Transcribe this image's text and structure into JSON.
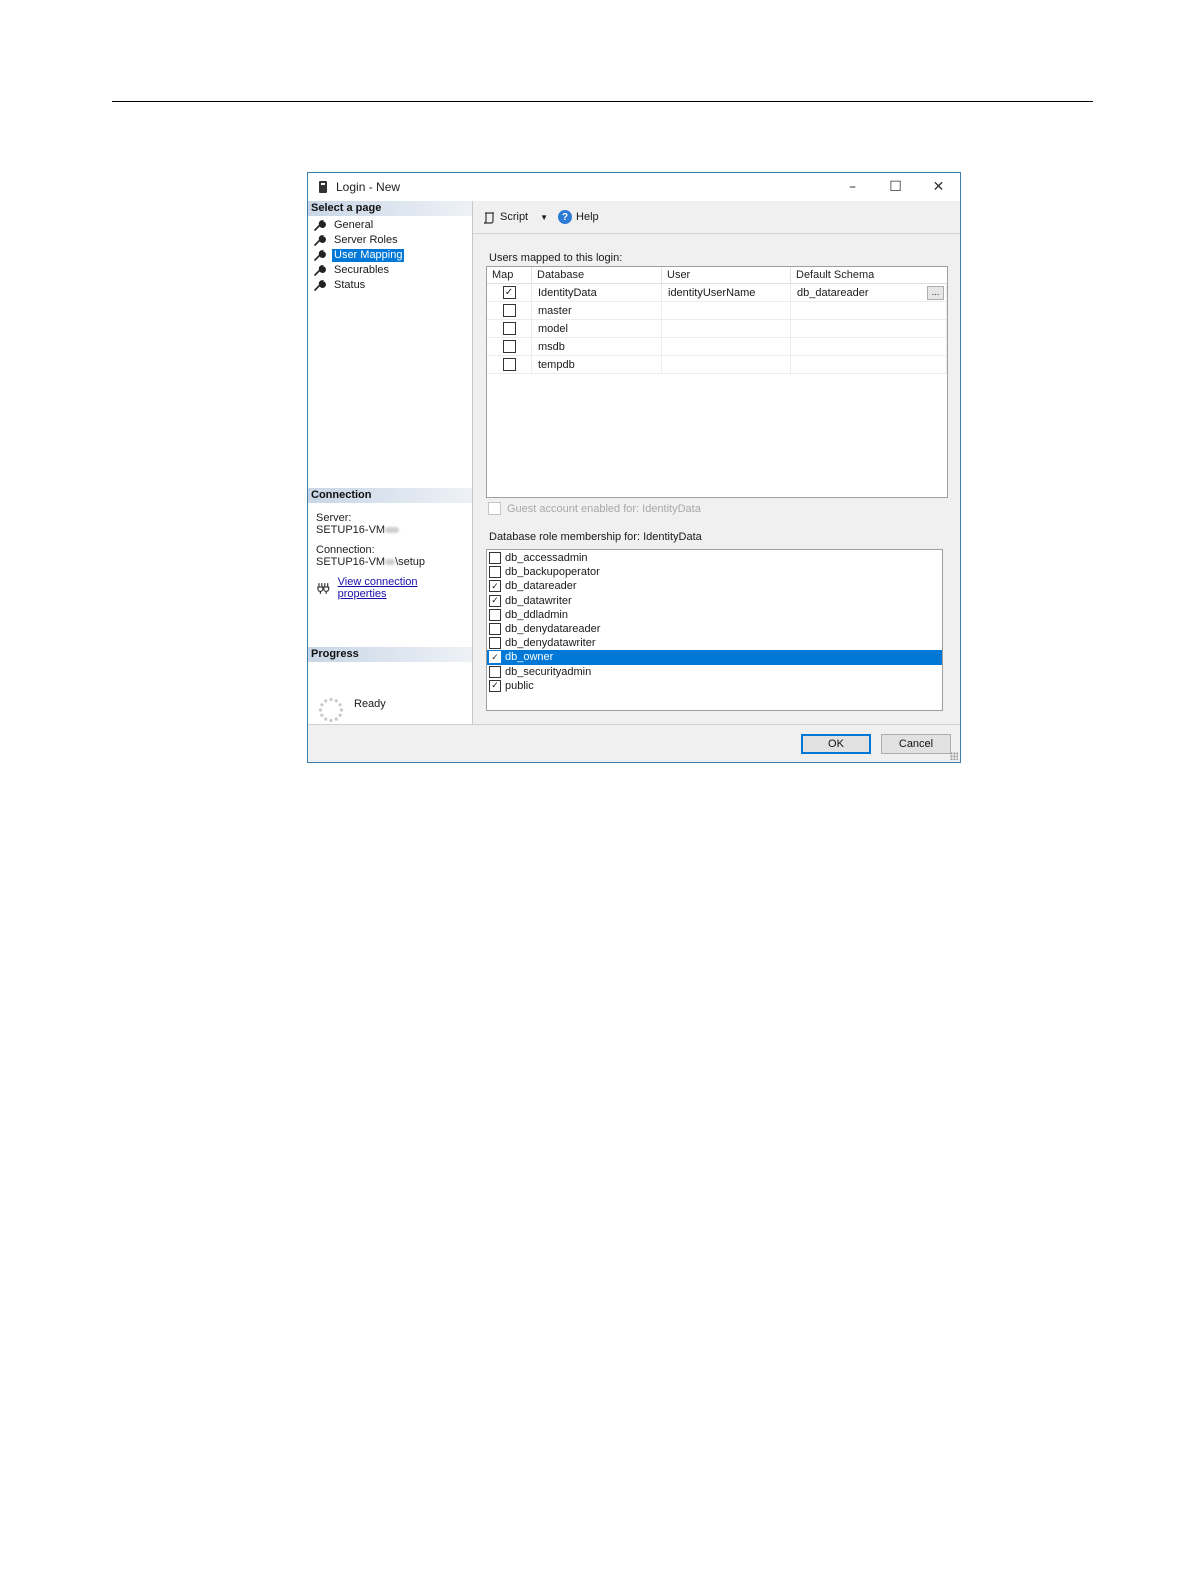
{
  "window": {
    "title": "Login - New",
    "controls": {
      "minimize": "–",
      "maximize": "☐",
      "close": "✕"
    }
  },
  "left_pane": {
    "select_page_header": "Select a page",
    "pages": [
      {
        "label": "General",
        "icon": "wrench-icon",
        "selected": false
      },
      {
        "label": "Server Roles",
        "icon": "wrench-icon",
        "selected": false
      },
      {
        "label": "User Mapping",
        "icon": "wrench-icon",
        "selected": true
      },
      {
        "label": "Securables",
        "icon": "wrench-icon",
        "selected": false
      },
      {
        "label": "Status",
        "icon": "wrench-icon",
        "selected": false
      }
    ],
    "connection_header": "Connection",
    "server_label": "Server:",
    "server_value": "SETUP16-VM",
    "connection_label": "Connection:",
    "connection_value_prefix": "SETUP16-VM",
    "connection_value_suffix": "\\setup",
    "view_connection_link": "View connection properties",
    "progress_header": "Progress",
    "progress_status": "Ready"
  },
  "toolbar": {
    "script_label": "Script",
    "help_label": "Help",
    "help_icon_glyph": "?"
  },
  "users_mapped": {
    "label": "Users mapped to this login:",
    "columns": [
      "Map",
      "Database",
      "User",
      "Default Schema"
    ],
    "ellipsis": "...",
    "rows": [
      {
        "map": true,
        "database": "IdentityData",
        "user": "identityUserName",
        "schema": "db_datareader"
      },
      {
        "map": false,
        "database": "master",
        "user": "",
        "schema": ""
      },
      {
        "map": false,
        "database": "model",
        "user": "",
        "schema": ""
      },
      {
        "map": false,
        "database": "msdb",
        "user": "",
        "schema": ""
      },
      {
        "map": false,
        "database": "tempdb",
        "user": "",
        "schema": ""
      }
    ]
  },
  "guest_account_label": "Guest account enabled for: IdentityData",
  "role_membership": {
    "label": "Database role membership for: IdentityData",
    "roles": [
      {
        "name": "db_accessadmin",
        "checked": false,
        "selected": false
      },
      {
        "name": "db_backupoperator",
        "checked": false,
        "selected": false
      },
      {
        "name": "db_datareader",
        "checked": true,
        "selected": false
      },
      {
        "name": "db_datawriter",
        "checked": true,
        "selected": false
      },
      {
        "name": "db_ddladmin",
        "checked": false,
        "selected": false
      },
      {
        "name": "db_denydatareader",
        "checked": false,
        "selected": false
      },
      {
        "name": "db_denydatawriter",
        "checked": false,
        "selected": false
      },
      {
        "name": "db_owner",
        "checked": true,
        "selected": true
      },
      {
        "name": "db_securityadmin",
        "checked": false,
        "selected": false
      },
      {
        "name": "public",
        "checked": true,
        "selected": false
      }
    ]
  },
  "footer": {
    "ok_label": "OK",
    "cancel_label": "Cancel"
  },
  "colors": {
    "accent": "#0078d7",
    "window_border": "#3c7fb1",
    "link": "#1a0dab"
  }
}
